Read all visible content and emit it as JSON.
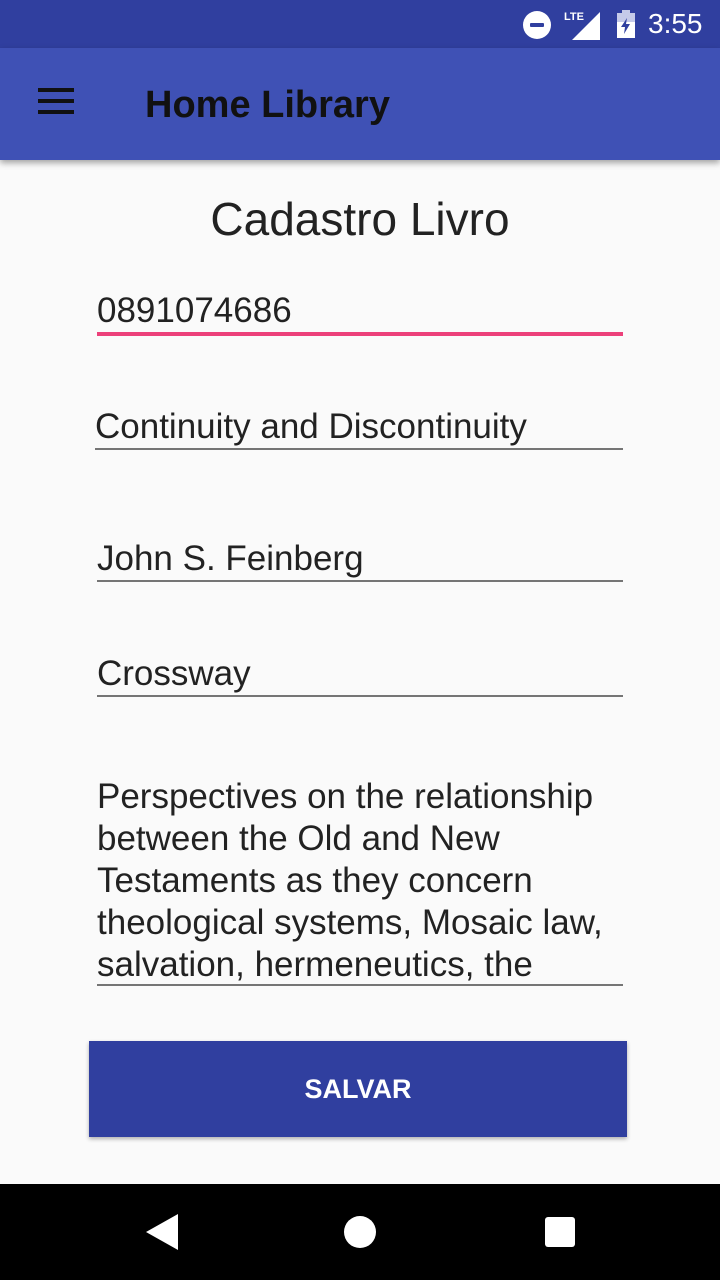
{
  "status_bar": {
    "time": "3:55",
    "network_label": "LTE",
    "icons": [
      "do-not-disturb-icon",
      "signal-icon",
      "battery-icon"
    ]
  },
  "app_bar": {
    "title": "Home Library",
    "menu_icon": "hamburger-menu-icon"
  },
  "form": {
    "title": "Cadastro Livro",
    "isbn": "0891074686",
    "book_title": "Continuity and Discontinuity",
    "author": "John S. Feinberg",
    "publisher": "Crossway",
    "description": "Perspectives on the relationship between the Old and New Testaments as they concern theological systems, Mosaic law, salvation, hermeneutics, the",
    "save_label": "SALVAR"
  },
  "nav_bar": {
    "icons": [
      "back-icon",
      "home-icon",
      "recent-apps-icon"
    ]
  },
  "colors": {
    "status_bar": "#303f9f",
    "app_bar": "#3f51b5",
    "accent": "#ec407a",
    "button": "#303f9f"
  }
}
